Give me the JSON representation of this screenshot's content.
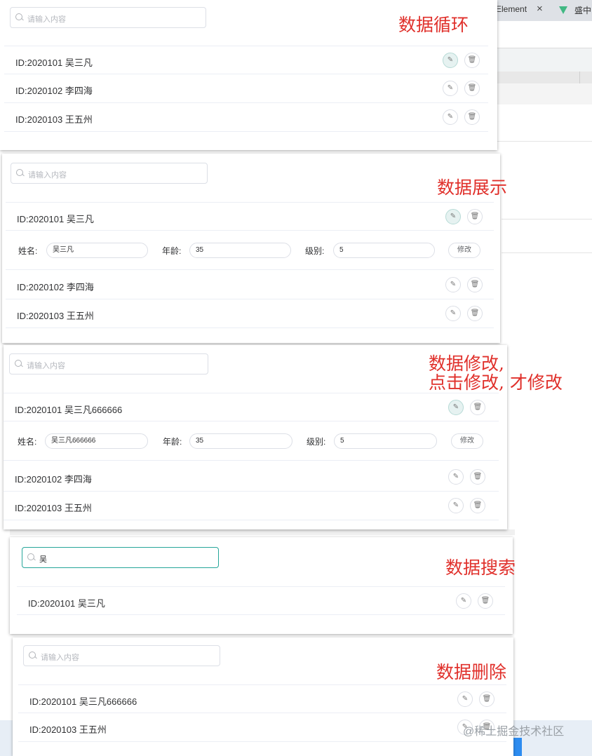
{
  "browser": {
    "tab1_label": "Element",
    "tab1_close": "×",
    "tab2_label": "盛中"
  },
  "panels": [
    {
      "annotation": "数据循环",
      "search": {
        "value": "",
        "placeholder": "请输入内容"
      },
      "rows": [
        {
          "label": "ID:2020101  吴三凡"
        },
        {
          "label": "ID:2020102  李四海"
        },
        {
          "label": "ID:2020103  王五州"
        }
      ]
    },
    {
      "annotation": "数据展示",
      "search": {
        "value": "",
        "placeholder": "请输入内容"
      },
      "rows": [
        {
          "label": "ID:2020101  吴三凡"
        },
        {
          "label": "ID:2020102  李四海"
        },
        {
          "label": "ID:2020103  王五州"
        }
      ],
      "form": {
        "name_label": "姓名:",
        "name_value": "吴三凡",
        "age_label": "年龄:",
        "age_value": "35",
        "level_label": "级别:",
        "level_value": "5",
        "submit_label": "修改"
      }
    },
    {
      "annotation_line1": "数据修改,",
      "annotation_line2": "点击修改, 才修改",
      "search": {
        "value": "",
        "placeholder": "请输入内容"
      },
      "rows": [
        {
          "label": "ID:2020101  吴三凡666666"
        },
        {
          "label": "ID:2020102  李四海"
        },
        {
          "label": "ID:2020103  王五州"
        }
      ],
      "form": {
        "name_label": "姓名:",
        "name_value": "吴三凡666666",
        "age_label": "年龄:",
        "age_value": "35",
        "level_label": "级别:",
        "level_value": "5",
        "submit_label": "修改"
      }
    },
    {
      "annotation": "数据搜索",
      "search": {
        "value": "吴",
        "placeholder": "请输入内容"
      },
      "rows": [
        {
          "label": "ID:2020101  吴三凡"
        }
      ]
    },
    {
      "annotation": "数据删除",
      "search": {
        "value": "",
        "placeholder": "请输入内容"
      },
      "rows": [
        {
          "label": "ID:2020101  吴三凡666666"
        },
        {
          "label": "ID:2020103  王五州"
        }
      ]
    }
  ],
  "icons": {
    "edit": "pencil-icon",
    "delete": "trash-icon"
  },
  "colors": {
    "annotation": "#e0302b",
    "focus_border": "#26a69a",
    "active_button_bg": "#e6f2f1"
  },
  "watermark": "@稀土掘金技术社区"
}
